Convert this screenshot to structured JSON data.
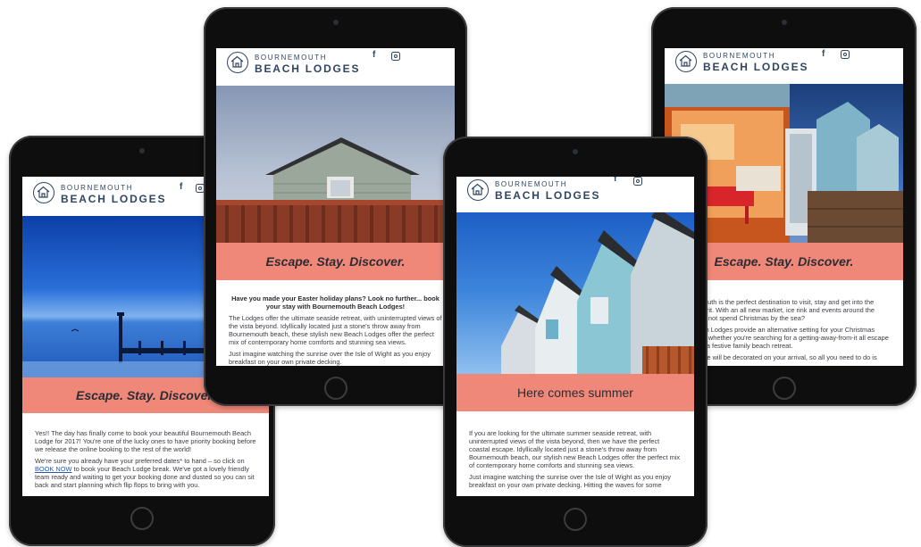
{
  "brand": {
    "line1": "BOURNEMOUTH",
    "line2": "BEACH LODGES",
    "facebook_icon": "f",
    "instagram_icon": "instagram-icon"
  },
  "colors": {
    "banner": "#f0887a",
    "brand_navy": "#2f4560",
    "device": "#0e0e0f"
  },
  "tablet1": {
    "banner": "Escape. Stay. Discover.",
    "paragraphs": [
      "Yes!! The day has finally come to book your beautiful Bournemouth Beach Lodge for 2017! You're one of the lucky ones to have priority booking before we release the online booking to the rest of the world!"
    ],
    "p2_before_link": "We're sure you already have your preferred dates* to hand – so click on ",
    "p2_link": "BOOK NOW",
    "p2_after_link": " to book your Beach Lodge break. We've got a lovely friendly team ready and waiting to get your booking done and dusted so you can sit back and start planning which flip flops to bring with you."
  },
  "tablet2": {
    "banner": "Escape. Stay. Discover.",
    "lead": "Have you made your Easter holiday plans? Look no further... book your stay with Bournemouth Beach Lodges!",
    "paragraphs": [
      "The Lodges offer the ultimate seaside retreat, with uninterrupted views of the vista beyond. Idyllically located just a stone's throw away from Bournemouth beach, these stylish new Beach Lodges offer the perfect mix of contemporary home comforts and stunning sea views.",
      "Just imagine watching the sunrise over the Isle of Wight as you enjoy breakfast on your own private decking."
    ]
  },
  "tablet3": {
    "banner": "Here comes summer",
    "paragraphs": [
      "If you are looking for the ultimate summer seaside retreat, with uninterrupted views of the vista beyond, then we have the perfect coastal escape. Idyllically located just a stone's throw away from Bournemouth beach, our stylish new Beach Lodges offer the perfect mix of contemporary home comforts and stunning sea views.",
      "Just imagine watching the sunrise over the Isle of Wight as you enjoy breakfast on your own private decking. Hitting the waves for some"
    ]
  },
  "tablet4": {
    "banner": "Escape. Stay. Discover.",
    "paragraphs": [
      "Bournemouth is the perfect destination to visit, stay and get into the festive spirit. With an all new market, ice rink and events around the town, why not spend Christmas by the sea?",
      "The Beach Lodges provide an alternative setting for your Christmas gathering, whether you're searching for a getting-away-from-it all escape for two or a festive family beach retreat.",
      "Your Lodge will be decorated on your arrival, so all you need to do is"
    ]
  }
}
